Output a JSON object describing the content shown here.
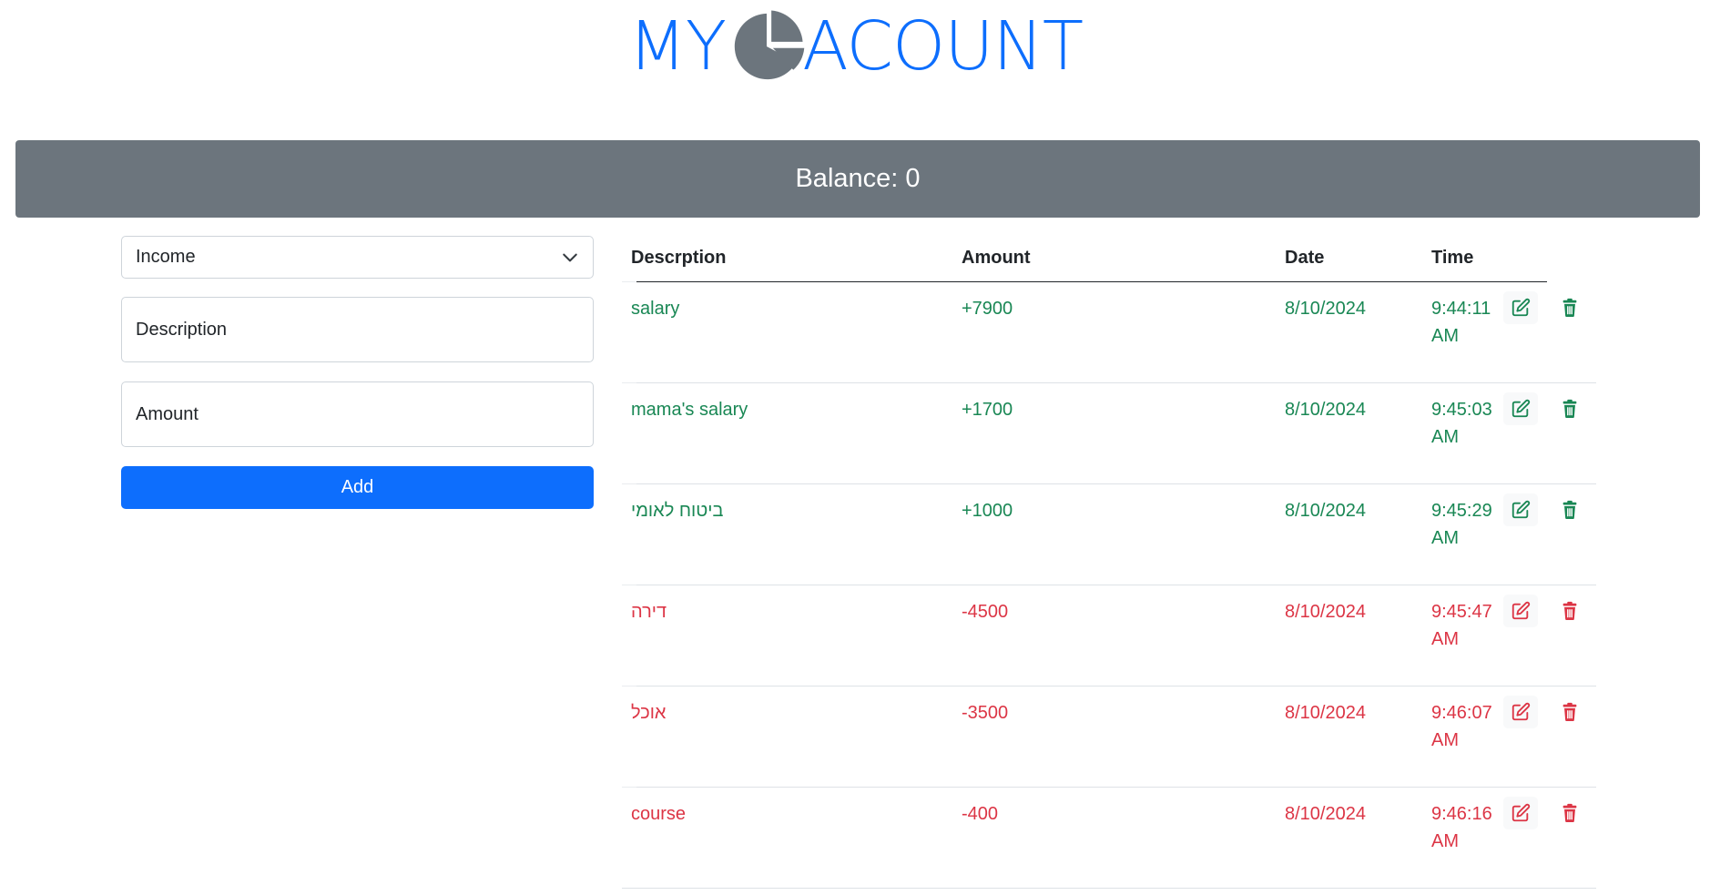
{
  "logo": {
    "left_text": "MY",
    "right_text": "ACOUNT"
  },
  "balance": {
    "label": "Balance: 0"
  },
  "form": {
    "type_selected": "Income",
    "description_placeholder": "Description",
    "amount_placeholder": "Amount",
    "add_label": "Add"
  },
  "table": {
    "headers": {
      "description": "Descrption",
      "amount": "Amount",
      "date": "Date",
      "time": "Time"
    },
    "rows": [
      {
        "description": "salary",
        "amount": "+7900",
        "date": "8/10/2024",
        "time": "9:44:11 AM",
        "kind": "income"
      },
      {
        "description": "mama's salary",
        "amount": "+1700",
        "date": "8/10/2024",
        "time": "9:45:03 AM",
        "kind": "income"
      },
      {
        "description": "ביטוח לאומי",
        "amount": "+1000",
        "date": "8/10/2024",
        "time": "9:45:29 AM",
        "kind": "income"
      },
      {
        "description": "דירה",
        "amount": "-4500",
        "date": "8/10/2024",
        "time": "9:45:47 AM",
        "kind": "expense"
      },
      {
        "description": "אוכל",
        "amount": "-3500",
        "date": "8/10/2024",
        "time": "9:46:07 AM",
        "kind": "expense"
      },
      {
        "description": "course",
        "amount": "-400",
        "date": "8/10/2024",
        "time": "9:46:16 AM",
        "kind": "expense"
      }
    ]
  },
  "colors": {
    "primary": "#0d6efd",
    "income": "#198754",
    "expense": "#dc3545",
    "balance_bg": "#6c757d"
  },
  "icons": {
    "edit": "edit-icon",
    "delete": "trash-icon",
    "logo": "pie-chart-icon",
    "select": "chevron-down-icon"
  }
}
